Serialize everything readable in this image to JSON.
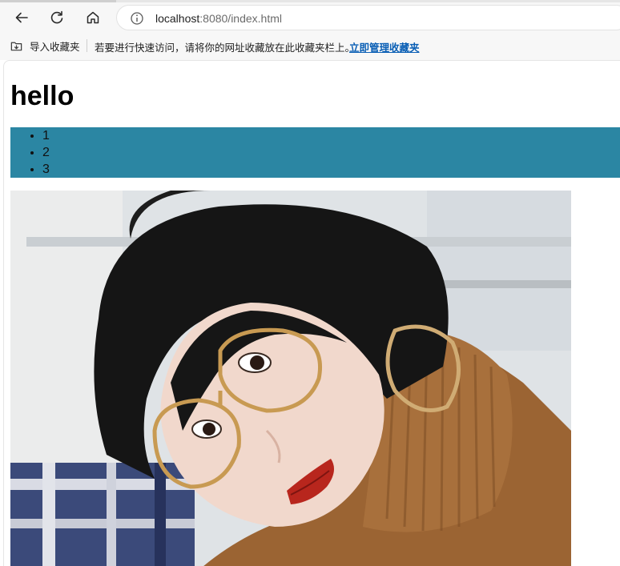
{
  "browser": {
    "address": {
      "host": "localhost",
      "rest": ":8080/index.html"
    },
    "favorites_bar": {
      "import_label": "导入收藏夹",
      "hint_text": "若要进行快速访问，请将你的网址收藏放在此收藏夹栏上。",
      "manage_link": "立即管理收藏夹"
    },
    "icons": [
      "back-arrow-icon",
      "refresh-icon",
      "home-icon",
      "info-icon",
      "favorites-import-icon"
    ]
  },
  "page": {
    "title": "hello",
    "list_items": [
      "1",
      "2",
      "3"
    ],
    "list_background": "#2b86a3",
    "image": {
      "subject": "photo"
    }
  }
}
